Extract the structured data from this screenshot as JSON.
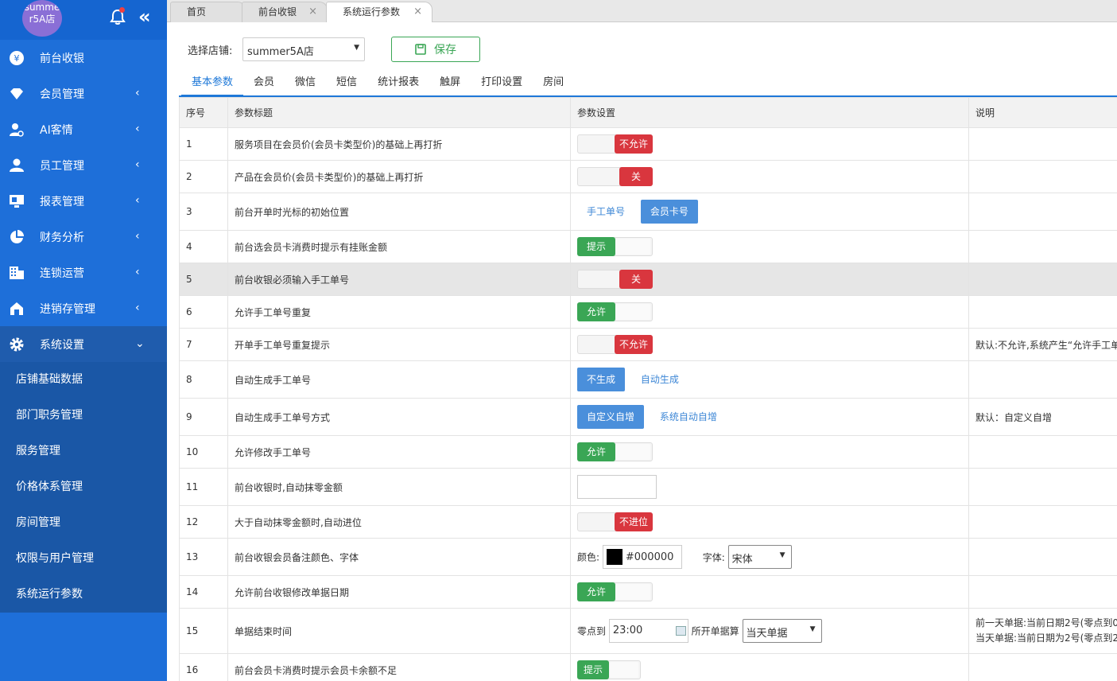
{
  "sidebar": {
    "avatar_text": "summer5A店",
    "avatar_line1": "summe",
    "avatar_line2": "r5A店",
    "items": [
      {
        "label": "前台收银",
        "icon": "yen-icon"
      },
      {
        "label": "会员管理",
        "icon": "diamond-icon"
      },
      {
        "label": "AI客情",
        "icon": "user-settings-icon"
      },
      {
        "label": "员工管理",
        "icon": "user-icon"
      },
      {
        "label": "报表管理",
        "icon": "monitor-icon"
      },
      {
        "label": "财务分析",
        "icon": "pie-chart-icon"
      },
      {
        "label": "连锁运营",
        "icon": "building-icon"
      },
      {
        "label": "进销存管理",
        "icon": "warehouse-icon"
      },
      {
        "label": "系统设置",
        "icon": "gear-icon"
      }
    ],
    "sub_items": [
      "店铺基础数据",
      "部门职务管理",
      "服务管理",
      "价格体系管理",
      "房间管理",
      "权限与用户管理",
      "系统运行参数"
    ]
  },
  "tabs": [
    {
      "label": "首页"
    },
    {
      "label": "前台收银",
      "close": "×"
    },
    {
      "label": "系统运行参数",
      "close": "×"
    }
  ],
  "store": {
    "label": "选择店铺:",
    "value": "summer5A店"
  },
  "save_label": "保存",
  "subtabs": [
    "基本参数",
    "会员",
    "微信",
    "短信",
    "统计报表",
    "触屏",
    "打印设置",
    "房间"
  ],
  "table": {
    "headers": [
      "序号",
      "参数标题",
      "参数设置",
      "说明"
    ],
    "rows": [
      {
        "no": "1",
        "title": "服务项目在会员价(会员卡类型价)的基础上再打折",
        "note": ""
      },
      {
        "no": "2",
        "title": "产品在会员价(会员卡类型价)的基础上再打折",
        "note": ""
      },
      {
        "no": "3",
        "title": "前台开单时光标的初始位置",
        "note": ""
      },
      {
        "no": "4",
        "title": "前台选会员卡消费时提示有挂账金额",
        "note": ""
      },
      {
        "no": "5",
        "title": "前台收银必须输入手工单号",
        "note": ""
      },
      {
        "no": "6",
        "title": "允许手工单号重复",
        "note": ""
      },
      {
        "no": "7",
        "title": "开单手工单号重复提示",
        "note": "默认:不允许,系统产生“允许手工单"
      },
      {
        "no": "8",
        "title": "自动生成手工单号",
        "note": ""
      },
      {
        "no": "9",
        "title": "自动生成手工单号方式",
        "note": "默认：自定义自增"
      },
      {
        "no": "10",
        "title": "允许修改手工单号",
        "note": ""
      },
      {
        "no": "11",
        "title": "前台收银时,自动抹零金额",
        "note": ""
      },
      {
        "no": "12",
        "title": "大于自动抹零金额时,自动进位",
        "note": ""
      },
      {
        "no": "13",
        "title": "前台收银会员备注颜色、字体",
        "note": ""
      },
      {
        "no": "14",
        "title": "允许前台收银修改单据日期",
        "note": ""
      },
      {
        "no": "15",
        "title": "单据结束时间",
        "note": "前一天单据:当前日期2号(零点到0",
        "note2": "当天单据:当前日期为2号(零点到2"
      },
      {
        "no": "16",
        "title": "前台会员卡消费时提示会员卡余额不足",
        "note": ""
      }
    ],
    "settings": {
      "r1": "不允许",
      "r2": "关",
      "r3_a": "手工单号",
      "r3_b": "会员卡号",
      "r4": "提示",
      "r5": "关",
      "r6": "允许",
      "r7": "不允许",
      "r8_a": "不生成",
      "r8_b": "自动生成",
      "r9_a": "自定义自增",
      "r9_b": "系统自动自增",
      "r10": "允许",
      "r11": "",
      "r12": "不进位",
      "r13_color_label": "颜色:",
      "r13_color": "#000000",
      "r13_font_label": "字体:",
      "r13_font": "宋体",
      "r14": "允许",
      "r15_label1": "零点到",
      "r15_time": "23:00",
      "r15_label2": "所开单据算",
      "r15_select": "当天单据",
      "r16": "提示"
    }
  },
  "colors": {
    "sidebar": "#1e6fd9",
    "accent": "#1e78d8",
    "toggle_on": "#3aa655",
    "toggle_off": "#d9363e",
    "option_selected": "#4a8fdb"
  }
}
